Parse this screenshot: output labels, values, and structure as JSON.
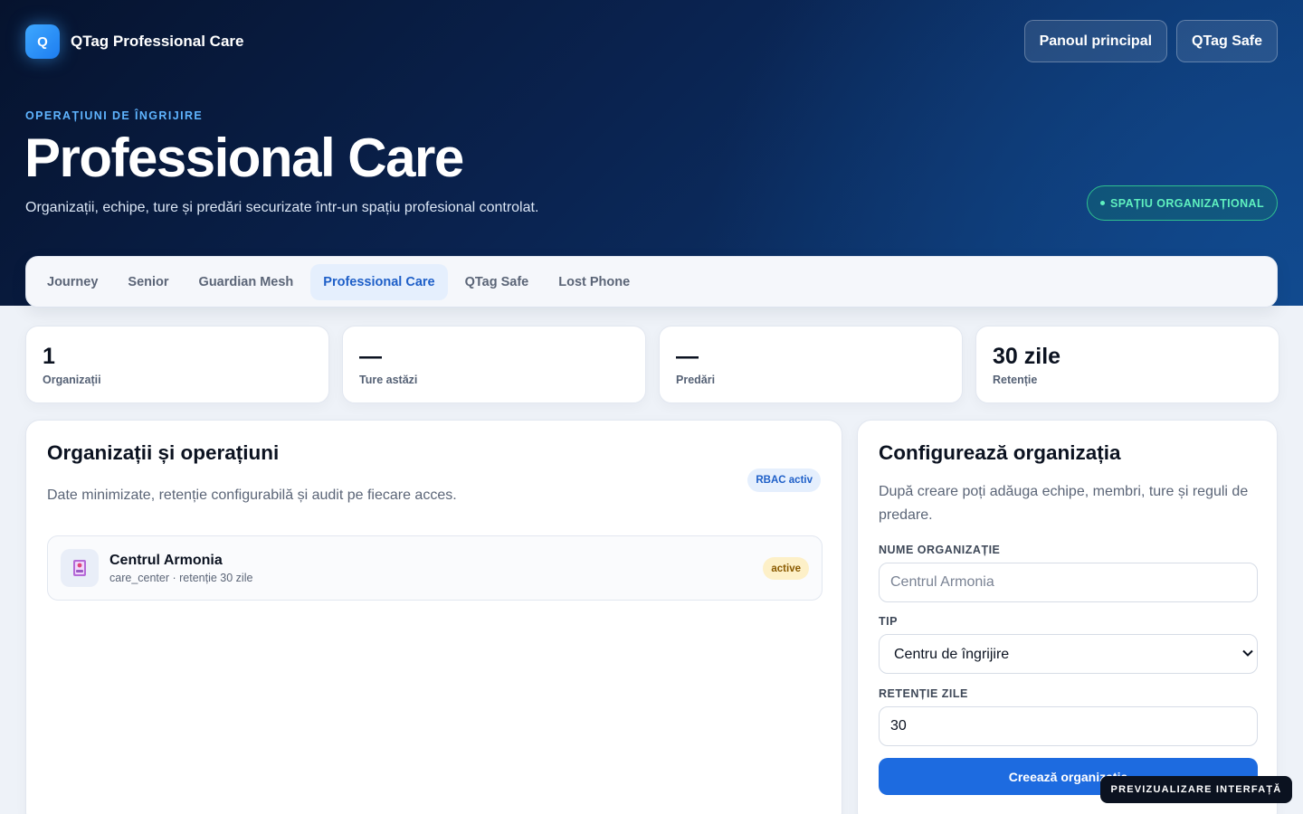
{
  "brand": {
    "logo_letter": "Q",
    "name": "QTag Professional Care"
  },
  "header_actions": {
    "dashboard": "Panoul principal",
    "safe": "QTag Safe"
  },
  "hero": {
    "eyebrow": "OPERAȚIUNI DE ÎNGRIJIRE",
    "title": "Professional Care",
    "subtitle": "Organizații, echipe, ture și predări securizate într-un spațiu profesional controlat.",
    "pill": "SPAȚIU ORGANIZAȚIONAL"
  },
  "tabs": [
    {
      "label": "Journey",
      "active": false
    },
    {
      "label": "Senior",
      "active": false
    },
    {
      "label": "Guardian Mesh",
      "active": false
    },
    {
      "label": "Professional Care",
      "active": true
    },
    {
      "label": "QTag Safe",
      "active": false
    },
    {
      "label": "Lost Phone",
      "active": false
    }
  ],
  "stats": [
    {
      "value": "1",
      "label": "Organizații"
    },
    {
      "value": "—",
      "label": "Ture astăzi"
    },
    {
      "value": "—",
      "label": "Predări"
    },
    {
      "value": "30 zile",
      "label": "Retenție"
    }
  ],
  "organizations_panel": {
    "title": "Organizații și operațiuni",
    "subtitle": "Date minimizate, retenție configurabilă și audit pe fiecare acces.",
    "badge": "RBAC activ",
    "items": [
      {
        "name": "Centrul Armonia",
        "meta": "care_center · retenție 30 zile",
        "status": "active",
        "icon": "care-center-icon"
      }
    ]
  },
  "config_panel": {
    "title": "Configurează organizația",
    "subtitle": "După creare poți adăuga echipe, membri, ture și reguli de predare.",
    "name_label": "NUME ORGANIZAȚIE",
    "name_placeholder": "Centrul Armonia",
    "type_label": "TIP",
    "type_value": "Centru de îngrijire",
    "retention_label": "RETENȚIE ZILE",
    "retention_value": "30",
    "submit": "Creează organizația"
  },
  "preview_badge": "PREVIZUALIZARE INTERFAȚĂ",
  "colors": {
    "accent": "#1d6be0",
    "hero_dark": "#06132e",
    "success": "#5ff0bf",
    "warning_bg": "#fdf0c8"
  }
}
